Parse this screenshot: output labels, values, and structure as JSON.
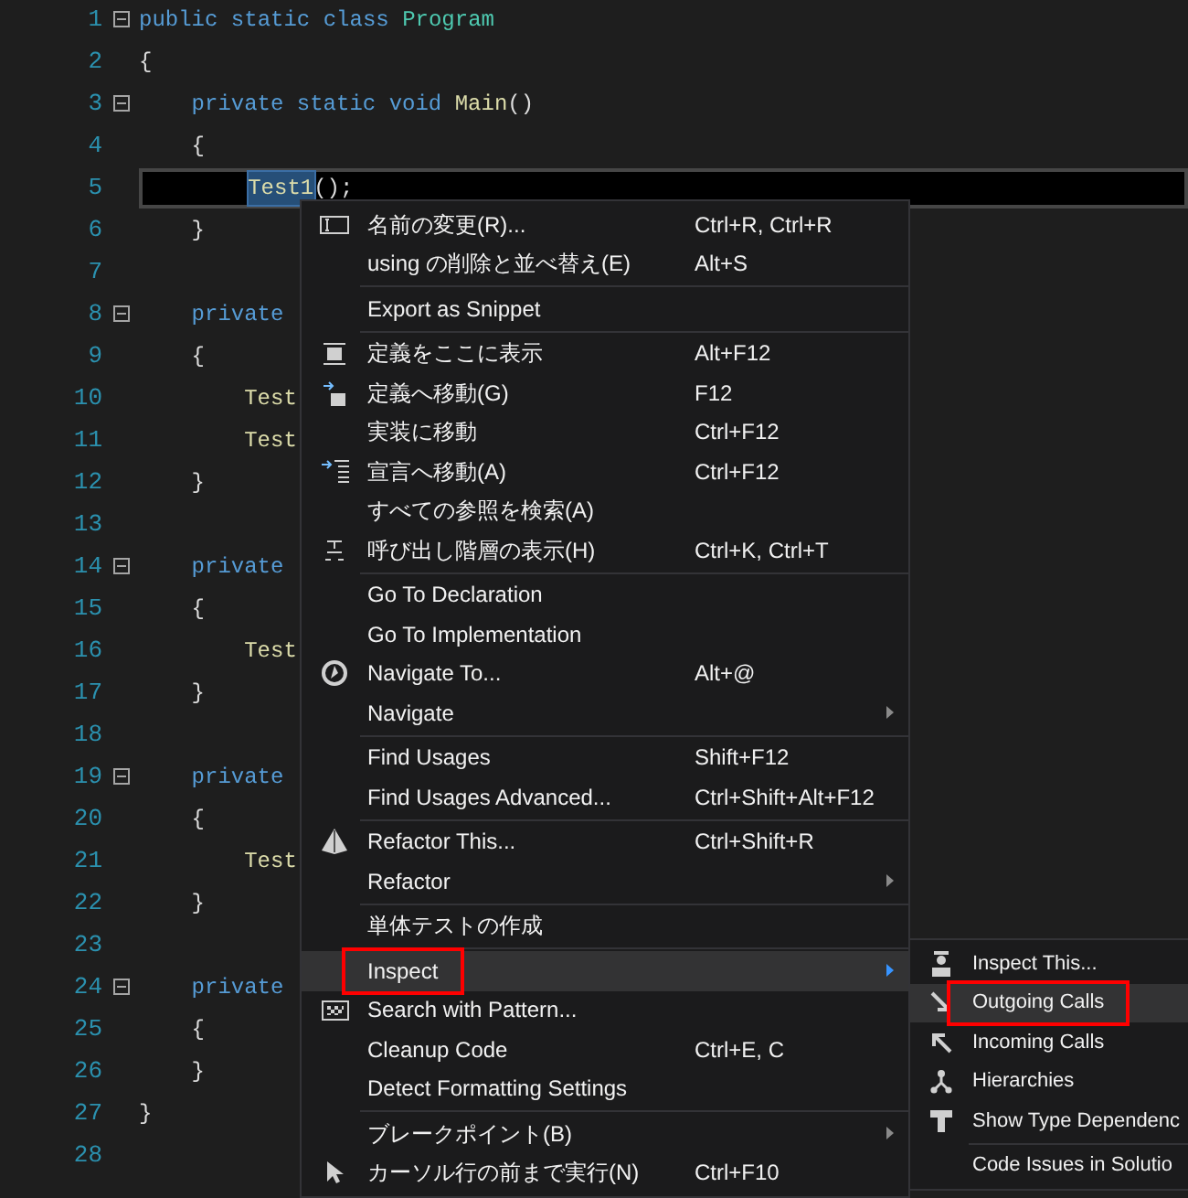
{
  "editor": {
    "lines": [
      {
        "number": "1",
        "fold": true,
        "current": false,
        "tokens": [
          {
            "text": "public ",
            "kind": "keyword",
            "selected": false
          },
          {
            "text": "static ",
            "kind": "keyword",
            "selected": false
          },
          {
            "text": "class ",
            "kind": "keyword",
            "selected": false
          },
          {
            "text": "Program",
            "kind": "type",
            "selected": false
          }
        ]
      },
      {
        "number": "2",
        "fold": false,
        "current": false,
        "tokens": [
          {
            "text": "{",
            "kind": "plain",
            "selected": false
          }
        ]
      },
      {
        "number": "3",
        "fold": true,
        "current": false,
        "tokens": [
          {
            "text": "private ",
            "kind": "keyword",
            "selected": false
          },
          {
            "text": "static ",
            "kind": "keyword",
            "selected": false
          },
          {
            "text": "void ",
            "kind": "keyword",
            "selected": false
          },
          {
            "text": "Main",
            "kind": "method",
            "selected": false
          },
          {
            "text": "()",
            "kind": "plain",
            "selected": false
          }
        ]
      },
      {
        "number": "4",
        "fold": false,
        "current": false,
        "tokens": [
          {
            "text": "{",
            "kind": "plain",
            "selected": false
          }
        ]
      },
      {
        "number": "5",
        "fold": false,
        "current": true,
        "tokens": [
          {
            "text": "Test1",
            "kind": "method",
            "selected": true
          },
          {
            "text": "();",
            "kind": "plain",
            "selected": false
          }
        ]
      },
      {
        "number": "6",
        "fold": false,
        "current": false,
        "tokens": [
          {
            "text": "}",
            "kind": "plain",
            "selected": false
          }
        ]
      },
      {
        "number": "7",
        "fold": false,
        "current": false
      },
      {
        "number": "8",
        "fold": true,
        "current": false,
        "tokens": [
          {
            "text": "private",
            "kind": "keyword",
            "selected": false
          }
        ]
      },
      {
        "number": "9",
        "fold": false,
        "current": false,
        "tokens": [
          {
            "text": "{",
            "kind": "plain",
            "selected": false
          }
        ]
      },
      {
        "number": "10",
        "fold": false,
        "current": false,
        "tokens": [
          {
            "text": "Test",
            "kind": "method",
            "selected": false
          }
        ]
      },
      {
        "number": "11",
        "fold": false,
        "current": false,
        "tokens": [
          {
            "text": "Test",
            "kind": "method",
            "selected": false
          }
        ]
      },
      {
        "number": "12",
        "fold": false,
        "current": false,
        "tokens": [
          {
            "text": "}",
            "kind": "plain",
            "selected": false
          }
        ]
      },
      {
        "number": "13",
        "fold": false,
        "current": false
      },
      {
        "number": "14",
        "fold": true,
        "current": false,
        "tokens": [
          {
            "text": "private",
            "kind": "keyword",
            "selected": false
          }
        ]
      },
      {
        "number": "15",
        "fold": false,
        "current": false,
        "tokens": [
          {
            "text": "{",
            "kind": "plain",
            "selected": false
          }
        ]
      },
      {
        "number": "16",
        "fold": false,
        "current": false,
        "tokens": [
          {
            "text": "Test",
            "kind": "method",
            "selected": false
          }
        ]
      },
      {
        "number": "17",
        "fold": false,
        "current": false,
        "tokens": [
          {
            "text": "}",
            "kind": "plain",
            "selected": false
          }
        ]
      },
      {
        "number": "18",
        "fold": false,
        "current": false
      },
      {
        "number": "19",
        "fold": true,
        "current": false,
        "tokens": [
          {
            "text": "private",
            "kind": "keyword",
            "selected": false
          }
        ]
      },
      {
        "number": "20",
        "fold": false,
        "current": false,
        "tokens": [
          {
            "text": "{",
            "kind": "plain",
            "selected": false
          }
        ]
      },
      {
        "number": "21",
        "fold": false,
        "current": false,
        "tokens": [
          {
            "text": "Test",
            "kind": "method",
            "selected": false
          }
        ]
      },
      {
        "number": "22",
        "fold": false,
        "current": false,
        "tokens": [
          {
            "text": "}",
            "kind": "plain",
            "selected": false
          }
        ]
      },
      {
        "number": "23",
        "fold": false,
        "current": false
      },
      {
        "number": "24",
        "fold": true,
        "current": false,
        "tokens": [
          {
            "text": "private",
            "kind": "keyword",
            "selected": false
          }
        ]
      },
      {
        "number": "25",
        "fold": false,
        "current": false,
        "tokens": [
          {
            "text": "{",
            "kind": "plain",
            "selected": false
          }
        ]
      },
      {
        "number": "26",
        "fold": false,
        "current": false,
        "tokens": [
          {
            "text": "}",
            "kind": "plain",
            "selected": false
          }
        ]
      },
      {
        "number": "27",
        "fold": false,
        "current": false,
        "tokens": [
          {
            "text": "}",
            "kind": "plain",
            "selected": false
          }
        ]
      },
      {
        "number": "28",
        "fold": false,
        "current": false
      }
    ]
  },
  "context_menu": {
    "groups": [
      [
        {
          "label": "名前の変更(R)...",
          "shortcut": "Ctrl+R, Ctrl+R",
          "has_submenu": false,
          "selected": false,
          "marked": false
        },
        {
          "label": "using の削除と並べ替え(E)",
          "shortcut": "Alt+S",
          "has_submenu": false,
          "selected": false,
          "marked": false
        }
      ],
      [
        {
          "label": "Export as Snippet",
          "has_submenu": false,
          "selected": false,
          "marked": false
        }
      ],
      [
        {
          "label": "定義をここに表示",
          "shortcut": "Alt+F12",
          "has_submenu": false,
          "selected": false,
          "marked": false
        },
        {
          "label": "定義へ移動(G)",
          "shortcut": "F12",
          "has_submenu": false,
          "selected": false,
          "marked": false
        },
        {
          "label": "実装に移動",
          "shortcut": "Ctrl+F12",
          "has_submenu": false,
          "selected": false,
          "marked": false
        },
        {
          "label": "宣言へ移動(A)",
          "shortcut": "Ctrl+F12",
          "has_submenu": false,
          "selected": false,
          "marked": false
        },
        {
          "label": "すべての参照を検索(A)",
          "has_submenu": false,
          "selected": false,
          "marked": false
        },
        {
          "label": "呼び出し階層の表示(H)",
          "shortcut": "Ctrl+K, Ctrl+T",
          "has_submenu": false,
          "selected": false,
          "marked": false
        }
      ],
      [
        {
          "label": "Go To Declaration",
          "has_submenu": false,
          "selected": false,
          "marked": false
        },
        {
          "label": "Go To Implementation",
          "has_submenu": false,
          "selected": false,
          "marked": false
        },
        {
          "label": "Navigate To...",
          "shortcut": "Alt+@",
          "has_submenu": false,
          "selected": false,
          "marked": false
        },
        {
          "label": "Navigate",
          "has_submenu": true,
          "selected": false,
          "marked": false
        }
      ],
      [
        {
          "label": "Find Usages",
          "shortcut": "Shift+F12",
          "has_submenu": false,
          "selected": false,
          "marked": false
        },
        {
          "label": "Find Usages Advanced...",
          "shortcut": "Ctrl+Shift+Alt+F12",
          "has_submenu": false,
          "selected": false,
          "marked": false
        }
      ],
      [
        {
          "label": "Refactor This...",
          "shortcut": "Ctrl+Shift+R",
          "has_submenu": false,
          "selected": false,
          "marked": false
        },
        {
          "label": "Refactor",
          "has_submenu": true,
          "selected": false,
          "marked": false
        }
      ],
      [
        {
          "label": "単体テストの作成",
          "has_submenu": false,
          "selected": false,
          "marked": false
        }
      ],
      [
        {
          "label": "Inspect",
          "has_submenu": true,
          "selected": true,
          "marked": true
        },
        {
          "label": "Search with Pattern...",
          "has_submenu": false,
          "selected": false,
          "marked": false
        },
        {
          "label": "Cleanup Code",
          "shortcut": "Ctrl+E, C",
          "has_submenu": false,
          "selected": false,
          "marked": false
        },
        {
          "label": "Detect Formatting Settings",
          "has_submenu": false,
          "selected": false,
          "marked": false
        }
      ],
      [
        {
          "label": "ブレークポイント(B)",
          "has_submenu": true,
          "selected": false,
          "marked": false
        },
        {
          "label": "カーソル行の前まで実行(N)",
          "shortcut": "Ctrl+F10",
          "has_submenu": false,
          "selected": false,
          "marked": false
        }
      ]
    ]
  },
  "submenu": {
    "groups": [
      [
        {
          "label": "Inspect This...",
          "selected": false,
          "marked": false
        },
        {
          "label": "Outgoing Calls",
          "selected": true,
          "marked": true
        },
        {
          "label": "Incoming Calls",
          "selected": false,
          "marked": false
        },
        {
          "label": "Hierarchies",
          "selected": false,
          "marked": false
        },
        {
          "label": "Show Type Dependenc",
          "selected": false,
          "marked": false
        }
      ],
      [
        {
          "label": "Code Issues in Solutio",
          "selected": false,
          "marked": false
        }
      ]
    ]
  }
}
